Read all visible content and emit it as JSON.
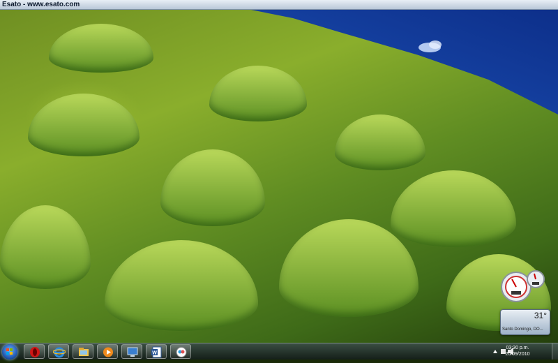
{
  "window": {
    "title": "Esato - www.esato.com"
  },
  "gadgets": {
    "weather": {
      "temperature": "31°",
      "location": "Santo Domingo, DO..."
    }
  },
  "taskbar": {
    "start_icon": "windows-orb-icon",
    "pinned": [
      {
        "name": "opera-icon"
      },
      {
        "name": "internet-explorer-icon"
      },
      {
        "name": "windows-explorer-icon"
      },
      {
        "name": "media-player-icon"
      },
      {
        "name": "remote-desktop-icon"
      },
      {
        "name": "word-icon"
      },
      {
        "name": "messenger-icon"
      }
    ],
    "clock": {
      "time": "03:30 p.m.",
      "date": "20/09/2010"
    }
  }
}
